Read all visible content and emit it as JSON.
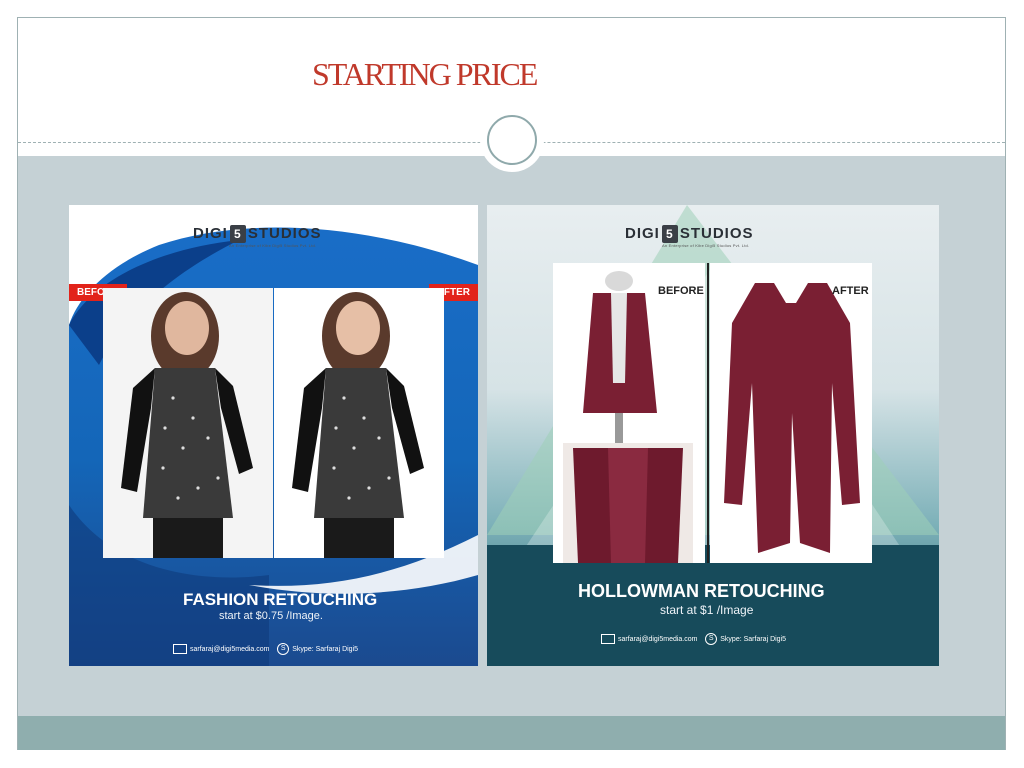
{
  "slide": {
    "title": "STARTING PRICE"
  },
  "cards": [
    {
      "logo": {
        "left": "DIGI",
        "mark": "5",
        "right": "STUDIOS",
        "tagline": "An Enterprise of Kibe Digi5 Studios Pvt. Ltd."
      },
      "before_label": "BEFORE",
      "after_label": "AFTER",
      "service": "FASHION RETOUCHING",
      "price": "start at $0.75 /Image.",
      "email": "sarfaraj@digi5media.com",
      "skype": "Skype: Sarfaraj Digi5"
    },
    {
      "logo": {
        "left": "DIGI",
        "mark": "5",
        "right": "STUDIOS",
        "tagline": "An Enterprise of Kibe Digi5 Studios Pvt. Ltd."
      },
      "before_label": "BEFORE",
      "after_label": "AFTER",
      "service": "HOLLOWMAN RETOUCHING",
      "price": "start at $1 /Image",
      "email": "sarfaraj@digi5media.com",
      "skype": "Skype: Sarfaraj Digi5"
    }
  ],
  "colors": {
    "title": "#c0392b",
    "panel": "#c5d1d5",
    "footer": "#8faeae",
    "tag": "#e2231a",
    "garment": "#7a1f33"
  }
}
